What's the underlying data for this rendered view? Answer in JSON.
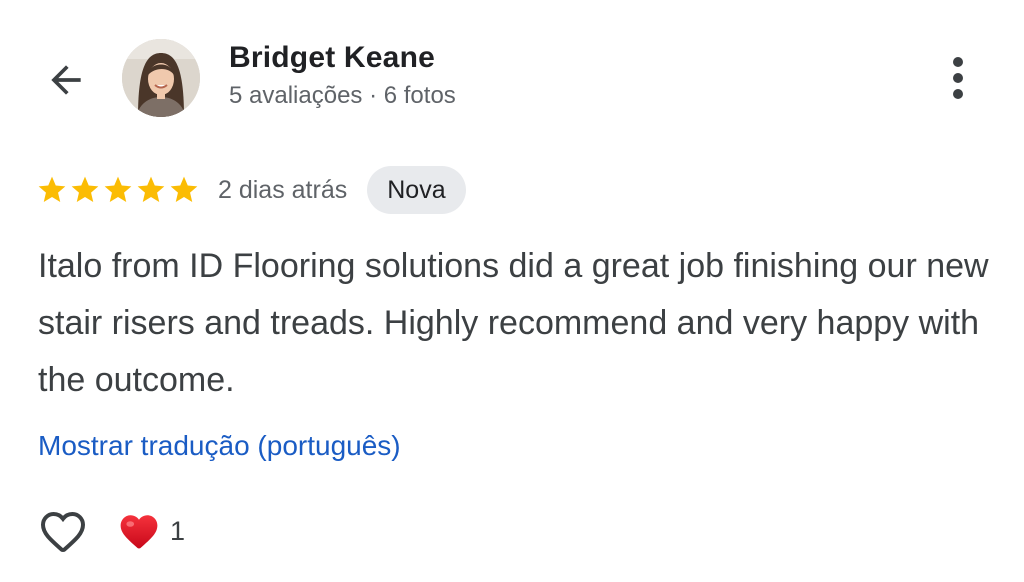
{
  "header": {
    "author_name": "Bridget Keane",
    "author_meta": "5 avaliações · 6 fotos",
    "back_icon": "arrow-left-icon",
    "more_icon": "more-vert-icon"
  },
  "review": {
    "rating": 5,
    "rating_max": 5,
    "date": "2 dias atrás",
    "badge": "Nova",
    "text": "Italo from ID Flooring solutions did a great job finishing our new stair risers and treads. Highly recommend and very happy with the outcome.",
    "translate_link": "Mostrar tradução (português)"
  },
  "reactions": {
    "like_icon": "heart-outline-icon",
    "reaction_icon": "red-heart-icon",
    "count": "1"
  },
  "colors": {
    "star": "#FBBC04",
    "link": "#1A5CC4",
    "badge_bg": "#E8EAED",
    "heart": "#E0101F",
    "secondary_text": "#5F6368"
  }
}
